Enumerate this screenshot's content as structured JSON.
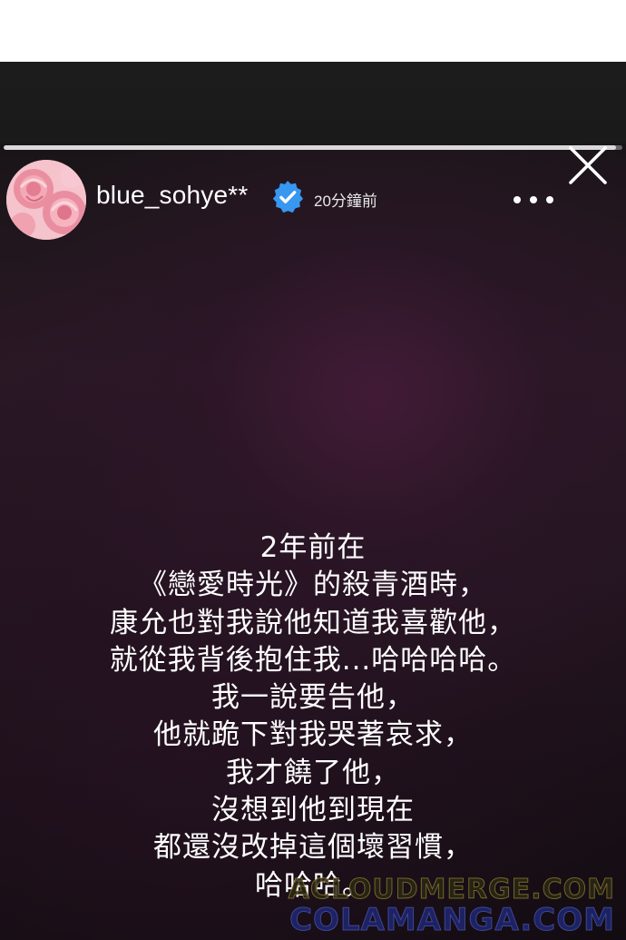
{
  "story": {
    "progress": 0.99,
    "user": {
      "username": "blue_sohye**",
      "verified": true,
      "timestamp": "20分鐘前",
      "avatar_icon": "rose-avatar-icon"
    },
    "controls": {
      "more_icon": "more-dots-icon",
      "close_icon": "close-icon"
    },
    "text_lines": [
      "2年前在",
      "《戀愛時光》的殺青酒時，",
      "康允也對我說他知道我喜歡他，",
      "就從我背後抱住我...哈哈哈哈。",
      "我一說要告他，",
      "他就跪下對我哭著哀求，",
      "我才饒了他，",
      "沒想到他到現在",
      "都還沒改掉這個壞習慣，",
      "哈哈哈。"
    ]
  },
  "watermarks": {
    "line1": "ACLOUDMERGE.COM",
    "line2": "COLAMANGA.COM"
  },
  "colors": {
    "verified_badge": "#3897f0",
    "text": "#ffffff",
    "background_dark": "#1a1a1a",
    "background_purple": "#2a1825"
  }
}
